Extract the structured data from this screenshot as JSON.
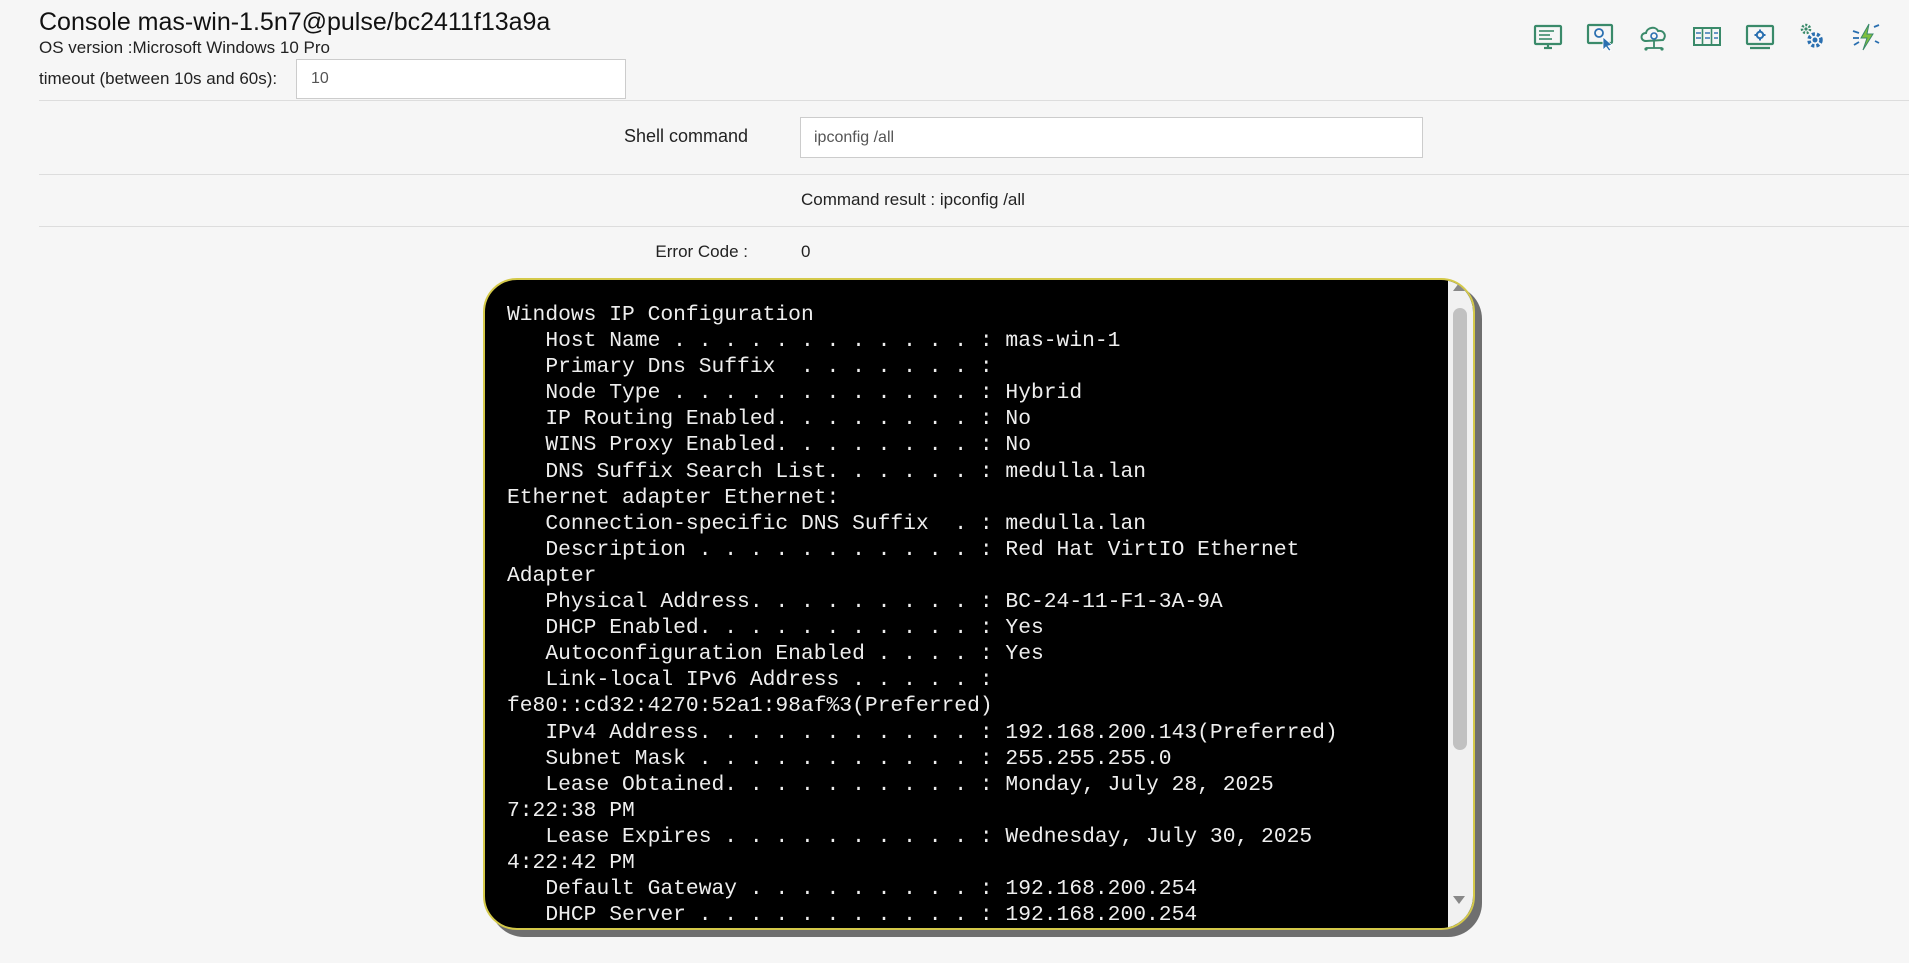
{
  "header": {
    "title": "Console mas-win-1.5n7@pulse/bc2411f13a9a",
    "os_version": "OS version :Microsoft Windows 10 Pro"
  },
  "timeout": {
    "label": "timeout (between 10s and 60s):",
    "value": "10"
  },
  "toolbar": {
    "icons": [
      "desktop-icon",
      "remote-control-icon",
      "cloud-network-icon",
      "inventory-icon",
      "screen-settings-icon",
      "gears-icon",
      "power-actions-icon"
    ]
  },
  "shell": {
    "label": "Shell command",
    "value": "ipconfig /all"
  },
  "result": {
    "label": "Command result : ipconfig /all",
    "error_label": "Error Code :",
    "error_value": "0"
  },
  "colors": {
    "icon_green": "#3a8a6a",
    "icon_blue": "#2a6fb0",
    "terminal_bg": "#000000",
    "terminal_border": "#d4c94a"
  },
  "terminal": {
    "output": "Windows IP Configuration\n   Host Name . . . . . . . . . . . . : mas-win-1\n   Primary Dns Suffix  . . . . . . . :\n   Node Type . . . . . . . . . . . . : Hybrid\n   IP Routing Enabled. . . . . . . . : No\n   WINS Proxy Enabled. . . . . . . . : No\n   DNS Suffix Search List. . . . . . : medulla.lan\nEthernet adapter Ethernet:\n   Connection-specific DNS Suffix  . : medulla.lan\n   Description . . . . . . . . . . . : Red Hat VirtIO Ethernet\nAdapter\n   Physical Address. . . . . . . . . : BC-24-11-F1-3A-9A\n   DHCP Enabled. . . . . . . . . . . : Yes\n   Autoconfiguration Enabled . . . . : Yes\n   Link-local IPv6 Address . . . . . :\nfe80::cd32:4270:52a1:98af%3(Preferred)\n   IPv4 Address. . . . . . . . . . . : 192.168.200.143(Preferred)\n   Subnet Mask . . . . . . . . . . . : 255.255.255.0\n   Lease Obtained. . . . . . . . . . : Monday, July 28, 2025\n7:22:38 PM\n   Lease Expires . . . . . . . . . . : Wednesday, July 30, 2025\n4:22:42 PM\n   Default Gateway . . . . . . . . . : 192.168.200.254\n   DHCP Server . . . . . . . . . . . : 192.168.200.254"
  }
}
